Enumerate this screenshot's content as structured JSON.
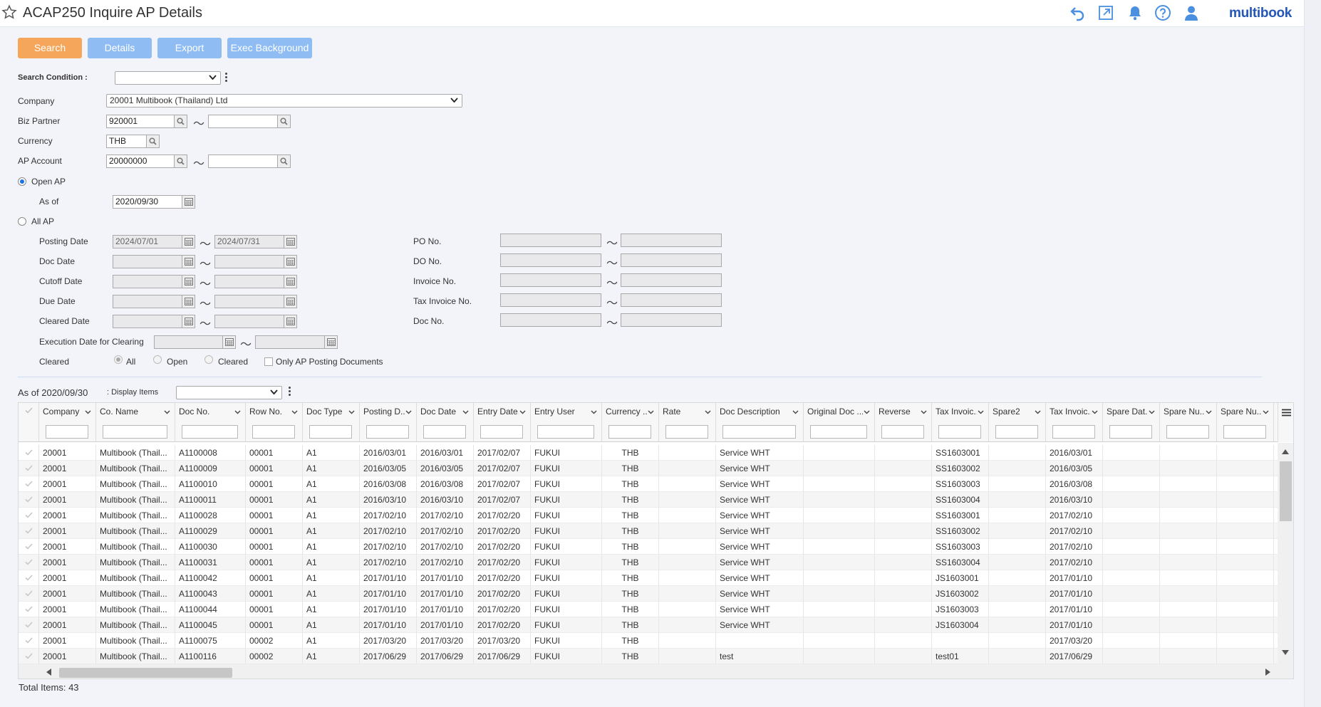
{
  "header": {
    "title": "ACAP250 Inquire AP Details",
    "logo": "multibook",
    "icons": [
      "star-icon",
      "undo-icon",
      "popout-icon",
      "bell-icon",
      "help-icon",
      "user-icon"
    ]
  },
  "toolbar": {
    "search": "Search",
    "details": "Details",
    "export": "Export",
    "exec_background": "Exec Background"
  },
  "form": {
    "search_condition_label": "Search Condition :",
    "company_label": "Company",
    "company_value": "20001 Multibook (Thailand) Ltd",
    "biz_partner_label": "Biz Partner",
    "biz_partner_from": "920001",
    "biz_partner_to": "",
    "currency_label": "Currency",
    "currency_value": "THB",
    "ap_account_label": "AP Account",
    "ap_account_from": "20000000",
    "ap_account_to": "",
    "open_ap_label": "Open AP",
    "as_of_label": "As of",
    "as_of_value": "2020/09/30",
    "all_ap_label": "All AP",
    "posting_date_label": "Posting Date",
    "posting_date_from": "2024/07/01",
    "posting_date_to": "2024/07/31",
    "doc_date_label": "Doc Date",
    "cutoff_date_label": "Cutoff Date",
    "due_date_label": "Due Date",
    "cleared_date_label": "Cleared Date",
    "exec_date_label": "Execution Date for Clearing",
    "cleared_label": "Cleared",
    "cleared_all": "All",
    "cleared_open": "Open",
    "cleared_cleared": "Cleared",
    "only_ap_label": "Only AP Posting Documents",
    "po_no_label": "PO No.",
    "do_no_label": "DO No.",
    "invoice_no_label": "Invoice No.",
    "tax_invoice_no_label": "Tax Invoice No.",
    "doc_no_label": "Doc No.",
    "tilde": "〜"
  },
  "result": {
    "as_of_text": "As of 2020/09/30",
    "display_items_label": ": Display Items",
    "total_text": "Total Items: 43"
  },
  "grid": {
    "columns": [
      "Company",
      "Co. Name",
      "Doc No.",
      "Row No.",
      "Doc Type",
      "Posting D...",
      "Doc Date",
      "Entry Date...",
      "Entry User",
      "Currency ...",
      "Rate",
      "Doc Description",
      "Original Doc ...",
      "Reverse",
      "Tax Invoic...",
      "Spare2",
      "Tax Invoic...",
      "Spare Dat...",
      "Spare Nu...",
      "Spare Nu..."
    ],
    "rows": [
      [
        "20001",
        "Multibook (Thail...",
        "A1100008",
        "00001",
        "A1",
        "2016/03/01",
        "2016/03/01",
        "2017/02/07",
        "FUKUI",
        "THB",
        "",
        "Service WHT",
        "",
        "",
        "SS1603001",
        "",
        "2016/03/01",
        "",
        "",
        ""
      ],
      [
        "20001",
        "Multibook (Thail...",
        "A1100009",
        "00001",
        "A1",
        "2016/03/05",
        "2016/03/05",
        "2017/02/07",
        "FUKUI",
        "THB",
        "",
        "Service WHT",
        "",
        "",
        "SS1603002",
        "",
        "2016/03/05",
        "",
        "",
        ""
      ],
      [
        "20001",
        "Multibook (Thail...",
        "A1100010",
        "00001",
        "A1",
        "2016/03/08",
        "2016/03/08",
        "2017/02/07",
        "FUKUI",
        "THB",
        "",
        "Service WHT",
        "",
        "",
        "SS1603003",
        "",
        "2016/03/08",
        "",
        "",
        ""
      ],
      [
        "20001",
        "Multibook (Thail...",
        "A1100011",
        "00001",
        "A1",
        "2016/03/10",
        "2016/03/10",
        "2017/02/07",
        "FUKUI",
        "THB",
        "",
        "Service WHT",
        "",
        "",
        "SS1603004",
        "",
        "2016/03/10",
        "",
        "",
        ""
      ],
      [
        "20001",
        "Multibook (Thail...",
        "A1100028",
        "00001",
        "A1",
        "2017/02/10",
        "2017/02/10",
        "2017/02/20",
        "FUKUI",
        "THB",
        "",
        "Service WHT",
        "",
        "",
        "SS1603001",
        "",
        "2017/02/10",
        "",
        "",
        ""
      ],
      [
        "20001",
        "Multibook (Thail...",
        "A1100029",
        "00001",
        "A1",
        "2017/02/10",
        "2017/02/10",
        "2017/02/20",
        "FUKUI",
        "THB",
        "",
        "Service WHT",
        "",
        "",
        "SS1603002",
        "",
        "2017/02/10",
        "",
        "",
        ""
      ],
      [
        "20001",
        "Multibook (Thail...",
        "A1100030",
        "00001",
        "A1",
        "2017/02/10",
        "2017/02/10",
        "2017/02/20",
        "FUKUI",
        "THB",
        "",
        "Service WHT",
        "",
        "",
        "SS1603003",
        "",
        "2017/02/10",
        "",
        "",
        ""
      ],
      [
        "20001",
        "Multibook (Thail...",
        "A1100031",
        "00001",
        "A1",
        "2017/02/10",
        "2017/02/10",
        "2017/02/20",
        "FUKUI",
        "THB",
        "",
        "Service WHT",
        "",
        "",
        "SS1603004",
        "",
        "2017/02/10",
        "",
        "",
        ""
      ],
      [
        "20001",
        "Multibook (Thail...",
        "A1100042",
        "00001",
        "A1",
        "2017/01/10",
        "2017/01/10",
        "2017/02/20",
        "FUKUI",
        "THB",
        "",
        "Service WHT",
        "",
        "",
        "JS1603001",
        "",
        "2017/01/10",
        "",
        "",
        ""
      ],
      [
        "20001",
        "Multibook (Thail...",
        "A1100043",
        "00001",
        "A1",
        "2017/01/10",
        "2017/01/10",
        "2017/02/20",
        "FUKUI",
        "THB",
        "",
        "Service WHT",
        "",
        "",
        "JS1603002",
        "",
        "2017/01/10",
        "",
        "",
        ""
      ],
      [
        "20001",
        "Multibook (Thail...",
        "A1100044",
        "00001",
        "A1",
        "2017/01/10",
        "2017/01/10",
        "2017/02/20",
        "FUKUI",
        "THB",
        "",
        "Service WHT",
        "",
        "",
        "JS1603003",
        "",
        "2017/01/10",
        "",
        "",
        ""
      ],
      [
        "20001",
        "Multibook (Thail...",
        "A1100045",
        "00001",
        "A1",
        "2017/01/10",
        "2017/01/10",
        "2017/02/20",
        "FUKUI",
        "THB",
        "",
        "Service WHT",
        "",
        "",
        "JS1603004",
        "",
        "2017/01/10",
        "",
        "",
        ""
      ],
      [
        "20001",
        "Multibook (Thail...",
        "A1100075",
        "00002",
        "A1",
        "2017/03/20",
        "2017/03/20",
        "2017/03/20",
        "FUKUI",
        "THB",
        "",
        "",
        "",
        "",
        "",
        "",
        "2017/03/20",
        "",
        "",
        ""
      ],
      [
        "20001",
        "Multibook (Thail...",
        "A1100116",
        "00002",
        "A1",
        "2017/06/29",
        "2017/06/29",
        "2017/06/29",
        "FUKUI",
        "THB",
        "",
        "test",
        "",
        "",
        "test01",
        "",
        "2017/06/29",
        "",
        "",
        ""
      ]
    ]
  }
}
